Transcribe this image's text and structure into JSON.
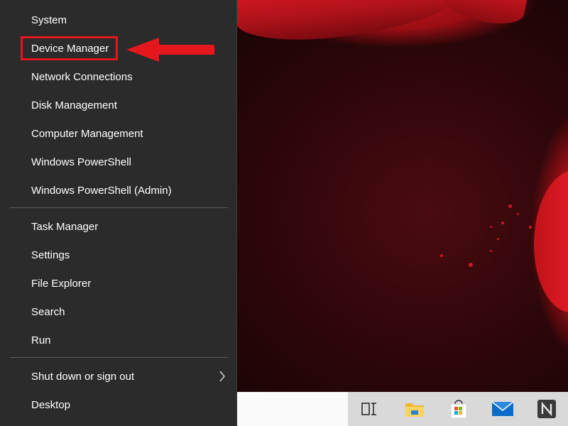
{
  "menu": {
    "items": [
      {
        "label": "System"
      },
      {
        "label": "Device Manager"
      },
      {
        "label": "Network Connections"
      },
      {
        "label": "Disk Management"
      },
      {
        "label": "Computer Management"
      },
      {
        "label": "Windows PowerShell"
      },
      {
        "label": "Windows PowerShell (Admin)"
      },
      {
        "label": "Task Manager"
      },
      {
        "label": "Settings"
      },
      {
        "label": "File Explorer"
      },
      {
        "label": "Search"
      },
      {
        "label": "Run"
      },
      {
        "label": "Shut down or sign out"
      },
      {
        "label": "Desktop"
      }
    ]
  },
  "annotation": {
    "highlight_color": "#e4161e",
    "target": "Device Manager"
  },
  "taskbar": {
    "icons": [
      "task-view-icon",
      "file-explorer-icon",
      "microsoft-store-icon",
      "mail-icon",
      "app-n-icon"
    ]
  },
  "colors": {
    "menu_bg": "#2b2b2b",
    "taskbar_bg": "#d9d9d9",
    "accent": "#e4161e"
  }
}
